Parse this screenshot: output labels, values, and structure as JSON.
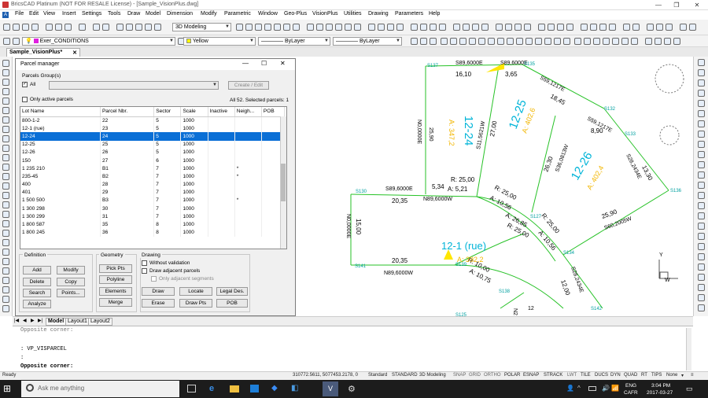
{
  "app": {
    "title": "BricsCAD Platinum (NOT FOR RESALE License) - [Sample_VisionPlus.dwg]"
  },
  "menu": [
    "File",
    "Edit",
    "View",
    "Insert",
    "Settings",
    "Tools",
    "Draw",
    "Model",
    "Dimension",
    "Modify",
    "Parametric",
    "Window",
    "Geo-Plus",
    "VisionPlus",
    "Utilities",
    "Drawing",
    "Parameters",
    "Help"
  ],
  "toolbar": {
    "workspace": "3D Modeling",
    "layer": "Exer_CONDITIONS",
    "color": "Yellow",
    "linetype": "ByLayer",
    "lineweight": "ByLayer"
  },
  "doc_tab": "Sample_VisionPlus*",
  "dialog": {
    "title": "Parcel manager",
    "groups_label": "Parcels Group(s)",
    "all_label": "All",
    "create_edit": "Create / Edit",
    "only_active": "Only active parcels",
    "summary": "All 52. Selected parcels: 1",
    "columns": [
      "Lot Name",
      "Parcel Nbr.",
      "Sector",
      "Scale",
      "Inactive",
      "Neigh...",
      "POB"
    ],
    "rows": [
      [
        "800-1-2",
        "22",
        "5",
        "1000",
        "",
        ""
      ],
      [
        "12-1 (rue)",
        "23",
        "5",
        "1000",
        "",
        ""
      ],
      [
        "12-24",
        "24",
        "5",
        "1000",
        "",
        ""
      ],
      [
        "12-25",
        "25",
        "5",
        "1000",
        "",
        ""
      ],
      [
        "12-26",
        "26",
        "5",
        "1000",
        "",
        ""
      ],
      [
        "150",
        "27",
        "6",
        "1000",
        "",
        ""
      ],
      [
        "1 235 210",
        "B1",
        "7",
        "1000",
        "",
        "*"
      ],
      [
        "235-45",
        "B2",
        "7",
        "1000",
        "",
        "*"
      ],
      [
        "400",
        "28",
        "7",
        "1000",
        "",
        ""
      ],
      [
        "401",
        "29",
        "7",
        "1000",
        "",
        ""
      ],
      [
        "1 500 500",
        "B3",
        "7",
        "1000",
        "",
        "*"
      ],
      [
        "1 300 298",
        "30",
        "7",
        "1000",
        "",
        ""
      ],
      [
        "1 300 299",
        "31",
        "7",
        "1000",
        "",
        ""
      ],
      [
        "1 800 587",
        "35",
        "8",
        "1000",
        "",
        ""
      ],
      [
        "1 800 245",
        "36",
        "8",
        "1000",
        "",
        ""
      ]
    ],
    "selected_row": 2,
    "definition": {
      "label": "Definition",
      "add": "Add",
      "modify": "Modify",
      "delete": "Delete",
      "copy": "Copy",
      "search": "Search",
      "points": "Points...",
      "analyze": "Analyze"
    },
    "geometry": {
      "label": "Geometry",
      "pick_pts": "Pick Pts",
      "polyline": "Polyline",
      "elements": "Elements",
      "merge": "Merge"
    },
    "drawing": {
      "label": "Drawing",
      "without_validation": "Without validation",
      "draw_adjacent": "Draw adjacent parcels",
      "only_adjacent": "Only adjacent segments",
      "draw": "Draw",
      "locate": "Locate",
      "legal_des": "Legal Des.",
      "erase": "Erase",
      "draw_pts": "Draw Pts",
      "pob": "POB"
    }
  },
  "cad": {
    "texts": [
      {
        "t": "S137",
        "c": "#00a0a0"
      },
      {
        "t": "S89,6000E",
        "c": "#000"
      },
      {
        "t": "S89,6000E",
        "c": "#000"
      },
      {
        "t": "S135",
        "c": "#00a0a0"
      },
      {
        "t": "16,10",
        "c": "#000"
      },
      {
        "t": "3,65",
        "c": "#000"
      },
      {
        "t": "S59,1217E",
        "c": "#000"
      },
      {
        "t": "18,45",
        "c": "#000"
      },
      {
        "t": "S132",
        "c": "#00a0a0"
      },
      {
        "t": "S59,1217E",
        "c": "#000"
      },
      {
        "t": "8,90",
        "c": "#000"
      },
      {
        "t": "S133",
        "c": "#00a0a0"
      },
      {
        "t": "S28,2434E",
        "c": "#000"
      },
      {
        "t": "13,30",
        "c": "#000"
      },
      {
        "t": "S136",
        "c": "#00a0a0"
      },
      {
        "t": "S130",
        "c": "#00a0a0"
      },
      {
        "t": "S89,6000E",
        "c": "#000"
      },
      {
        "t": "5,34",
        "c": "#000"
      },
      {
        "t": "20,35",
        "c": "#000"
      },
      {
        "t": "N89,6000W",
        "c": "#000"
      },
      {
        "t": "R: 25,00",
        "c": "#000"
      },
      {
        "t": "A: 5,21",
        "c": "#000"
      },
      {
        "t": "R: 25,00",
        "c": "#000"
      },
      {
        "t": "A: 10,56",
        "c": "#000"
      },
      {
        "t": "A: 26,85",
        "c": "#000"
      },
      {
        "t": "R: 25,00",
        "c": "#000"
      },
      {
        "t": "S127",
        "c": "#00a0a0"
      },
      {
        "t": "R: 25,00",
        "c": "#000"
      },
      {
        "t": "A: 10,56",
        "c": "#000"
      },
      {
        "t": "25,90",
        "c": "#000"
      },
      {
        "t": "S60,2005W",
        "c": "#000"
      },
      {
        "t": "S134",
        "c": "#00a0a0"
      },
      {
        "t": "20,35",
        "c": "#000"
      },
      {
        "t": "N89,6000W",
        "c": "#000"
      },
      {
        "t": "S141",
        "c": "#00a0a0"
      },
      {
        "t": "S139",
        "c": "#00a0a0"
      },
      {
        "t": "R: 10,00",
        "c": "#000"
      },
      {
        "t": "A: 10,75",
        "c": "#000"
      },
      {
        "t": "S138",
        "c": "#00a0a0"
      },
      {
        "t": "S142",
        "c": "#00a0a0"
      },
      {
        "t": "S125",
        "c": "#00a0a0"
      },
      {
        "t": "12,00",
        "c": "#000"
      },
      {
        "t": "S28,2434E",
        "c": "#000"
      },
      {
        "t": "25,90",
        "c": "#000"
      },
      {
        "t": "N0,0000E",
        "c": "#000"
      },
      {
        "t": "15,00",
        "c": "#000"
      },
      {
        "t": "N0,0000E",
        "c": "#000"
      },
      {
        "t": "27,00",
        "c": "#000"
      },
      {
        "t": "S11,5621W",
        "c": "#000"
      },
      {
        "t": "26,30",
        "c": "#000"
      },
      {
        "t": "S36,0813W",
        "c": "#000"
      },
      {
        "t": "12-24",
        "c": "#00b4d8"
      },
      {
        "t": "A: 347,2",
        "c": "#f2b600"
      },
      {
        "t": "12-25",
        "c": "#00b4d8"
      },
      {
        "t": "A: 402,6",
        "c": "#f2b600"
      },
      {
        "t": "12-26",
        "c": "#00b4d8"
      },
      {
        "t": "A: 402,4",
        "c": "#f2b600"
      },
      {
        "t": "12-1 (rue)",
        "c": "#00b4d8"
      },
      {
        "t": "A: 392,2",
        "c": "#f2b600"
      },
      {
        "t": "N2",
        "c": "#000"
      },
      {
        "t": "12",
        "c": "#000"
      },
      {
        "t": "Y",
        "c": "#000"
      },
      {
        "t": "W",
        "c": "#000"
      }
    ]
  },
  "model_tabs": [
    "Model",
    "Layout1",
    "Layout2"
  ],
  "command": {
    "lines": [
      "Opposite corner:",
      ": VP_VISPARCEL",
      ":"
    ],
    "prompt": "Opposite corner:"
  },
  "status": {
    "ready": "Ready",
    "coords": "310772.5611, 5077453.2178, 0",
    "items": [
      "Standard",
      "STANDARD",
      "3D Modeling",
      "SNAP",
      "GRID",
      "ORTHO",
      "POLAR",
      "ESNAP",
      "STRACK",
      "LWT",
      "TILE",
      "DUCS",
      "DYN",
      "QUAD",
      "RT",
      "TIPS",
      "None"
    ]
  },
  "taskbar": {
    "search_placeholder": "Ask me anything",
    "lang": "ENG",
    "locale": "CAFR",
    "time": "3:04 PM",
    "date": "2017-03-27"
  }
}
